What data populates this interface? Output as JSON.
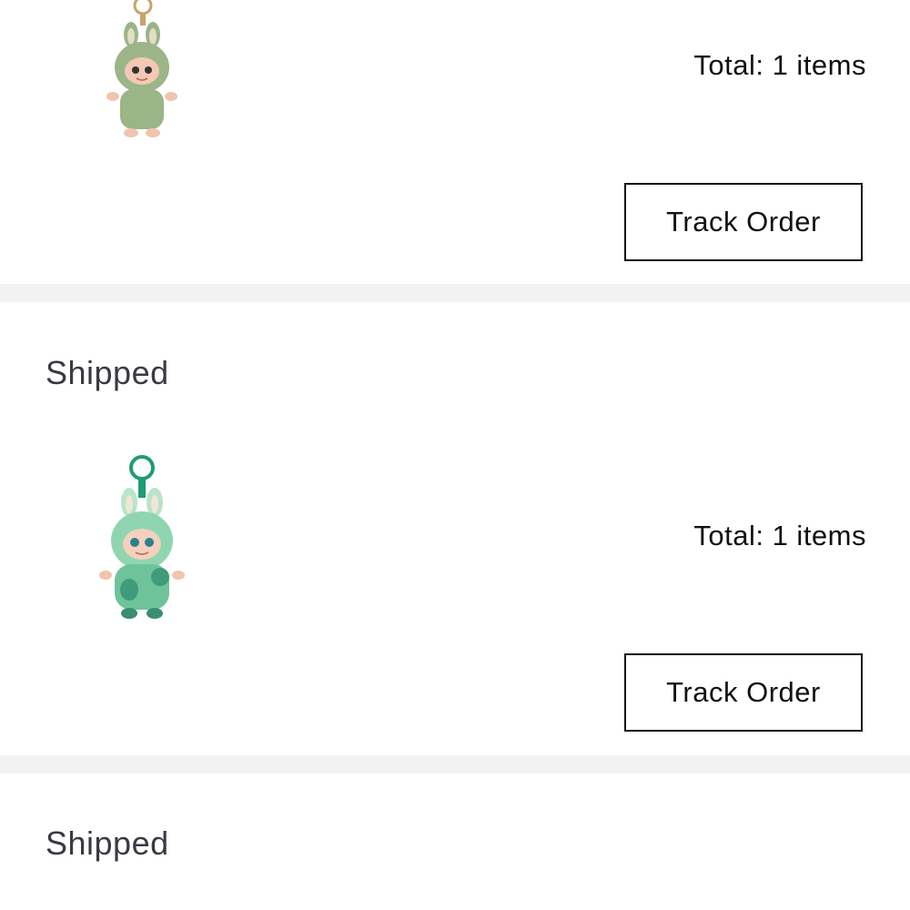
{
  "orders": [
    {
      "status": "",
      "product_image": "green-plush-keychain-image",
      "total_label": "Total: 1 items",
      "action_label": "Track Order"
    },
    {
      "status": "Shipped",
      "product_image": "mint-plush-keychain-image",
      "total_label": "Total: 1 items",
      "action_label": "Track Order"
    },
    {
      "status": "Shipped"
    }
  ],
  "colors": {
    "divider": "#f2f2f2",
    "status_text": "#3a3a44",
    "button_border": "#111111"
  }
}
